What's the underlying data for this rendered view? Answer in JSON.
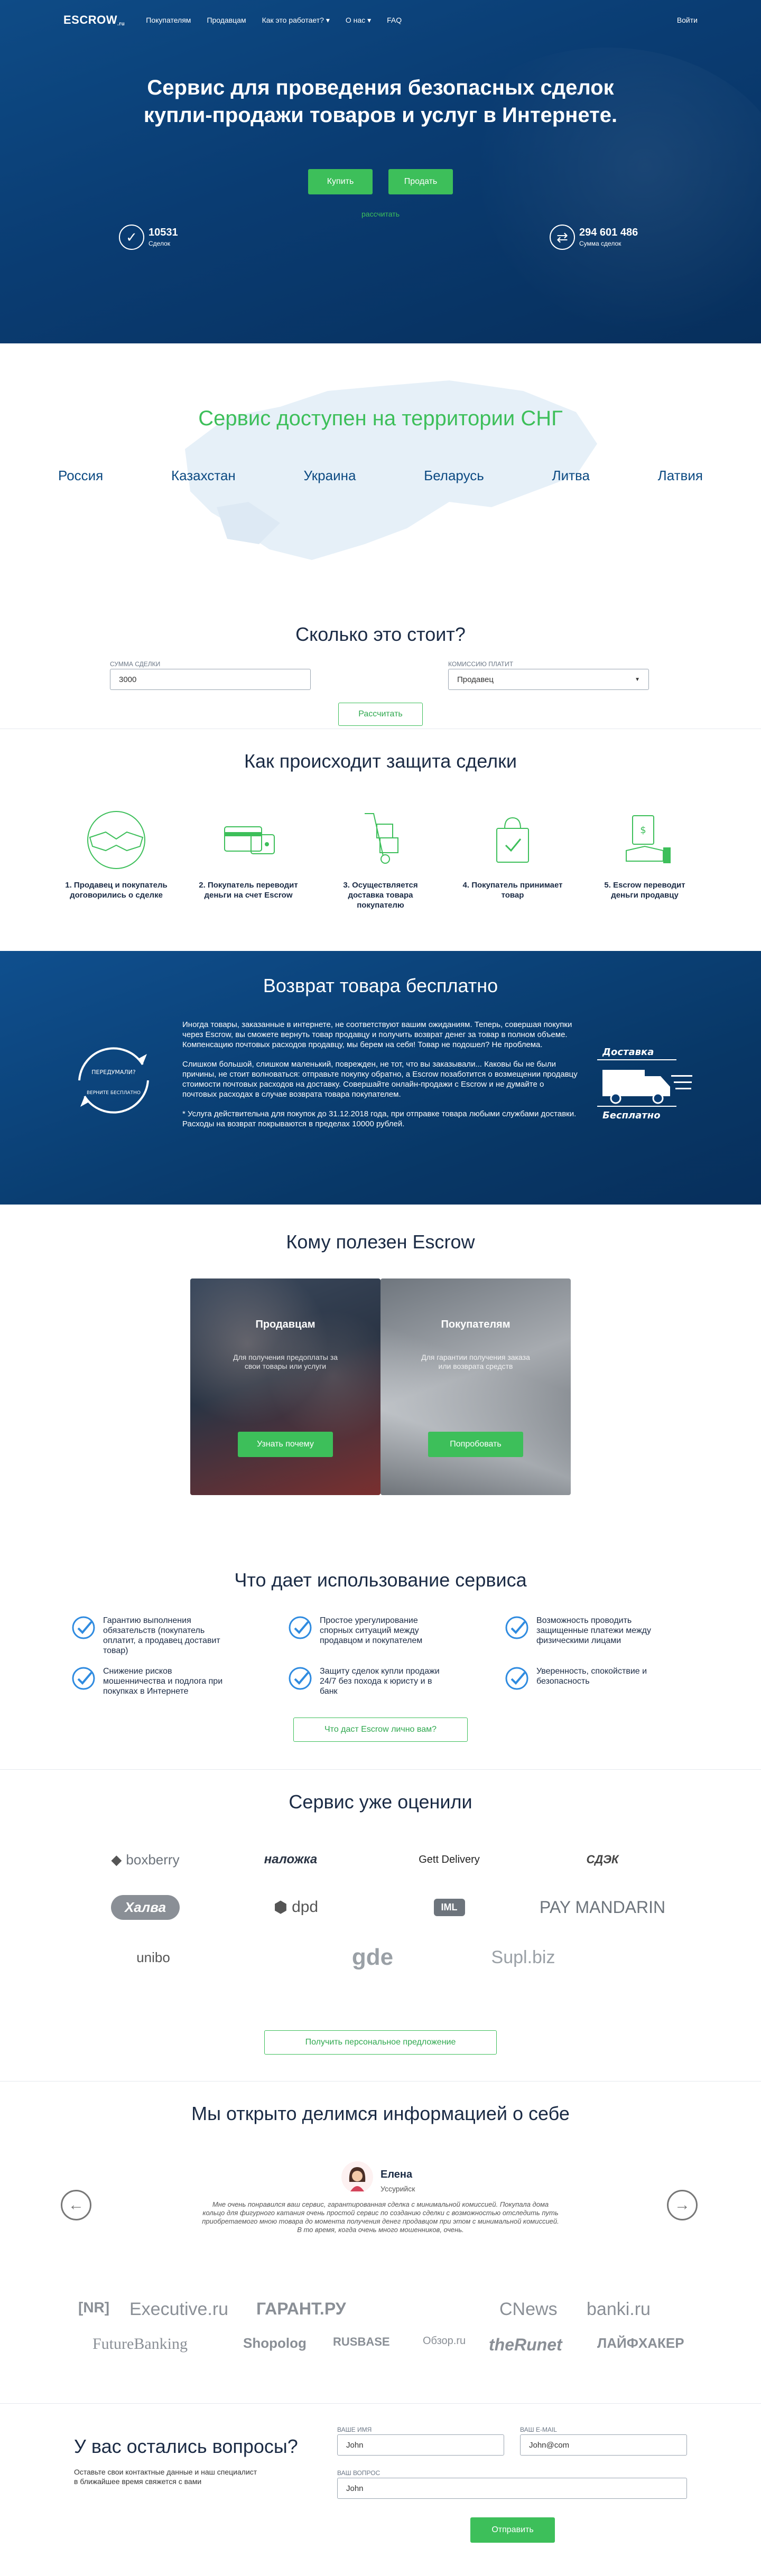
{
  "nav": {
    "logo": "ESCROW",
    "items": [
      "Покупателям",
      "Продавцам",
      "Как это работает?",
      "О нас",
      "FAQ"
    ],
    "login": "Войти"
  },
  "hero": {
    "title": "Сервис для проведения безопасных сделок купли-продажи товаров и услуг в Интернете.",
    "buy": "Купить",
    "sell": "Продать",
    "calc_link": "рассчитать",
    "deals_count": "10531",
    "deals_label": "Сделок",
    "sum_value": "294 601 486",
    "sum_label": "Сумма сделок"
  },
  "cis": {
    "title": "Сервис доступен на территории СНГ",
    "countries": [
      "Россия",
      "Казахстан",
      "Украина",
      "Беларусь",
      "Литва",
      "Латвия"
    ]
  },
  "cost": {
    "title": "Сколько это стоит?",
    "amount_label": "СУММА СДЕЛКИ",
    "amount_value": "3000",
    "fee_label": "КОМИССИЮ ПЛАТИТ",
    "fee_value": "Продавец",
    "button": "Рассчитать"
  },
  "protection": {
    "title": "Как происходит защита сделки",
    "steps": [
      "1. Продавец и покупатель договорились о сделке",
      "2. Покупатель переводит деньги на счет Escrow",
      "3. Осуществляется доставка товара покупателю",
      "4. Покупатель принимает товар",
      "5. Escrow переводит деньги продавцу"
    ]
  },
  "return": {
    "title": "Возврат товара бесплатно",
    "p1": "Иногда товары, заказанные в интернете, не соответствуют вашим ожиданиям. Теперь, совершая покупки через Escrow, вы сможете вернуть товар продавцу и получить возврат денег за товар в полном объеме. Компенсацию почтовых расходов продавцу, мы берем на себя! Товар не подошел? Не проблема.",
    "p2": "Слишком большой, слишком маленький, поврежден, не тот, что вы заказывали... Каковы бы не были причины, не стоит волноваться: отправьте покупку обратно, а Escrow позаботится о возмещении продавцу стоимости почтовых расходов на доставку. Совершайте онлайн-продажи с Escrow и не думайте о почтовых расходах в случае возврата товара покупателем.",
    "p3": "* Услуга действительна для покупок до 31.12.2018 года, при отправке товара любыми службами доставки. Расходы на возврат покрываются в пределах 10000 рублей.",
    "badge_top": "ПЕРЕДУМАЛИ?",
    "badge_bottom": "ВЕРНИТЕ БЕСПЛАТНО",
    "delivery_top": "Доставка",
    "delivery_bottom": "Бесплатно"
  },
  "who": {
    "title": "Кому полезен Escrow",
    "sellers_title": "Продавцам",
    "sellers_desc": "Для получения предоплаты за свои товары или услуги",
    "sellers_btn": "Узнать почему",
    "buyers_title": "Покупателям",
    "buyers_desc": "Для гарантии получения заказа или возврата средств",
    "buyers_btn": "Попробовать"
  },
  "benefits": {
    "title": "Что дает использование сервиса",
    "items": [
      "Гарантию выполнения обязательств (покупатель оплатит, а продавец доставит товар)",
      "Простое урегулирование спорных ситуаций между продавцом и покупателем",
      "Возможность проводить защищенные платежи между физическими лицами",
      "Снижение рисков мошенничества и подлога при покупках в Интернете",
      "Защиту сделок купли продажи 24/7 без похода к юристу и в банк",
      "Уверенность, спокойствие и безопасность"
    ],
    "button": "Что даст Escrow лично вам?"
  },
  "rated": {
    "title": "Сервис уже оценили",
    "logos": [
      "boxberry",
      "наложка",
      "Gett Delivery",
      "СДЭК",
      "Халва",
      "dpd",
      "IML",
      "PAY MANDARIN",
      "unibo",
      "gde",
      "Supl.biz"
    ],
    "button": "Получить персональное предложение"
  },
  "open": {
    "title": "Мы открыто делимся информацией о себе",
    "name": "Елена",
    "city": "Уссурийск",
    "text": "Мне очень понравился ваш сервис, гарантированная сделка с минимальной комиссией. Покупала дома кольцо для фигурного катания очень простой сервис по созданию сделки с возможностью отследить путь приобретаемого мною товара до момента получения денег продавцом при этом с минимальной комиссией. В то время, когда очень много мошенников, очень.",
    "prev": "←",
    "next": "→",
    "media": [
      "[NR]",
      "Executive.ru",
      "ГАРАНТ.РУ",
      "CNews",
      "banki.ru",
      "FutureBanking",
      "Shopolog",
      "RUSBASE",
      "Обзор.ru",
      "theRunet",
      "ЛАЙФХАКЕР"
    ]
  },
  "contact": {
    "title": "У вас остались вопросы?",
    "sub": "Оставьте свои контактные данные и наш специалист в ближайшее время свяжется с вами",
    "name_label": "ВАШЕ ИМЯ",
    "name_value": "John",
    "email_label": "ВАШ E-MAIL",
    "email_value": "John@com",
    "question_label": "ВАШ ВОПРОС",
    "question_value": "John",
    "button": "Отправить"
  }
}
